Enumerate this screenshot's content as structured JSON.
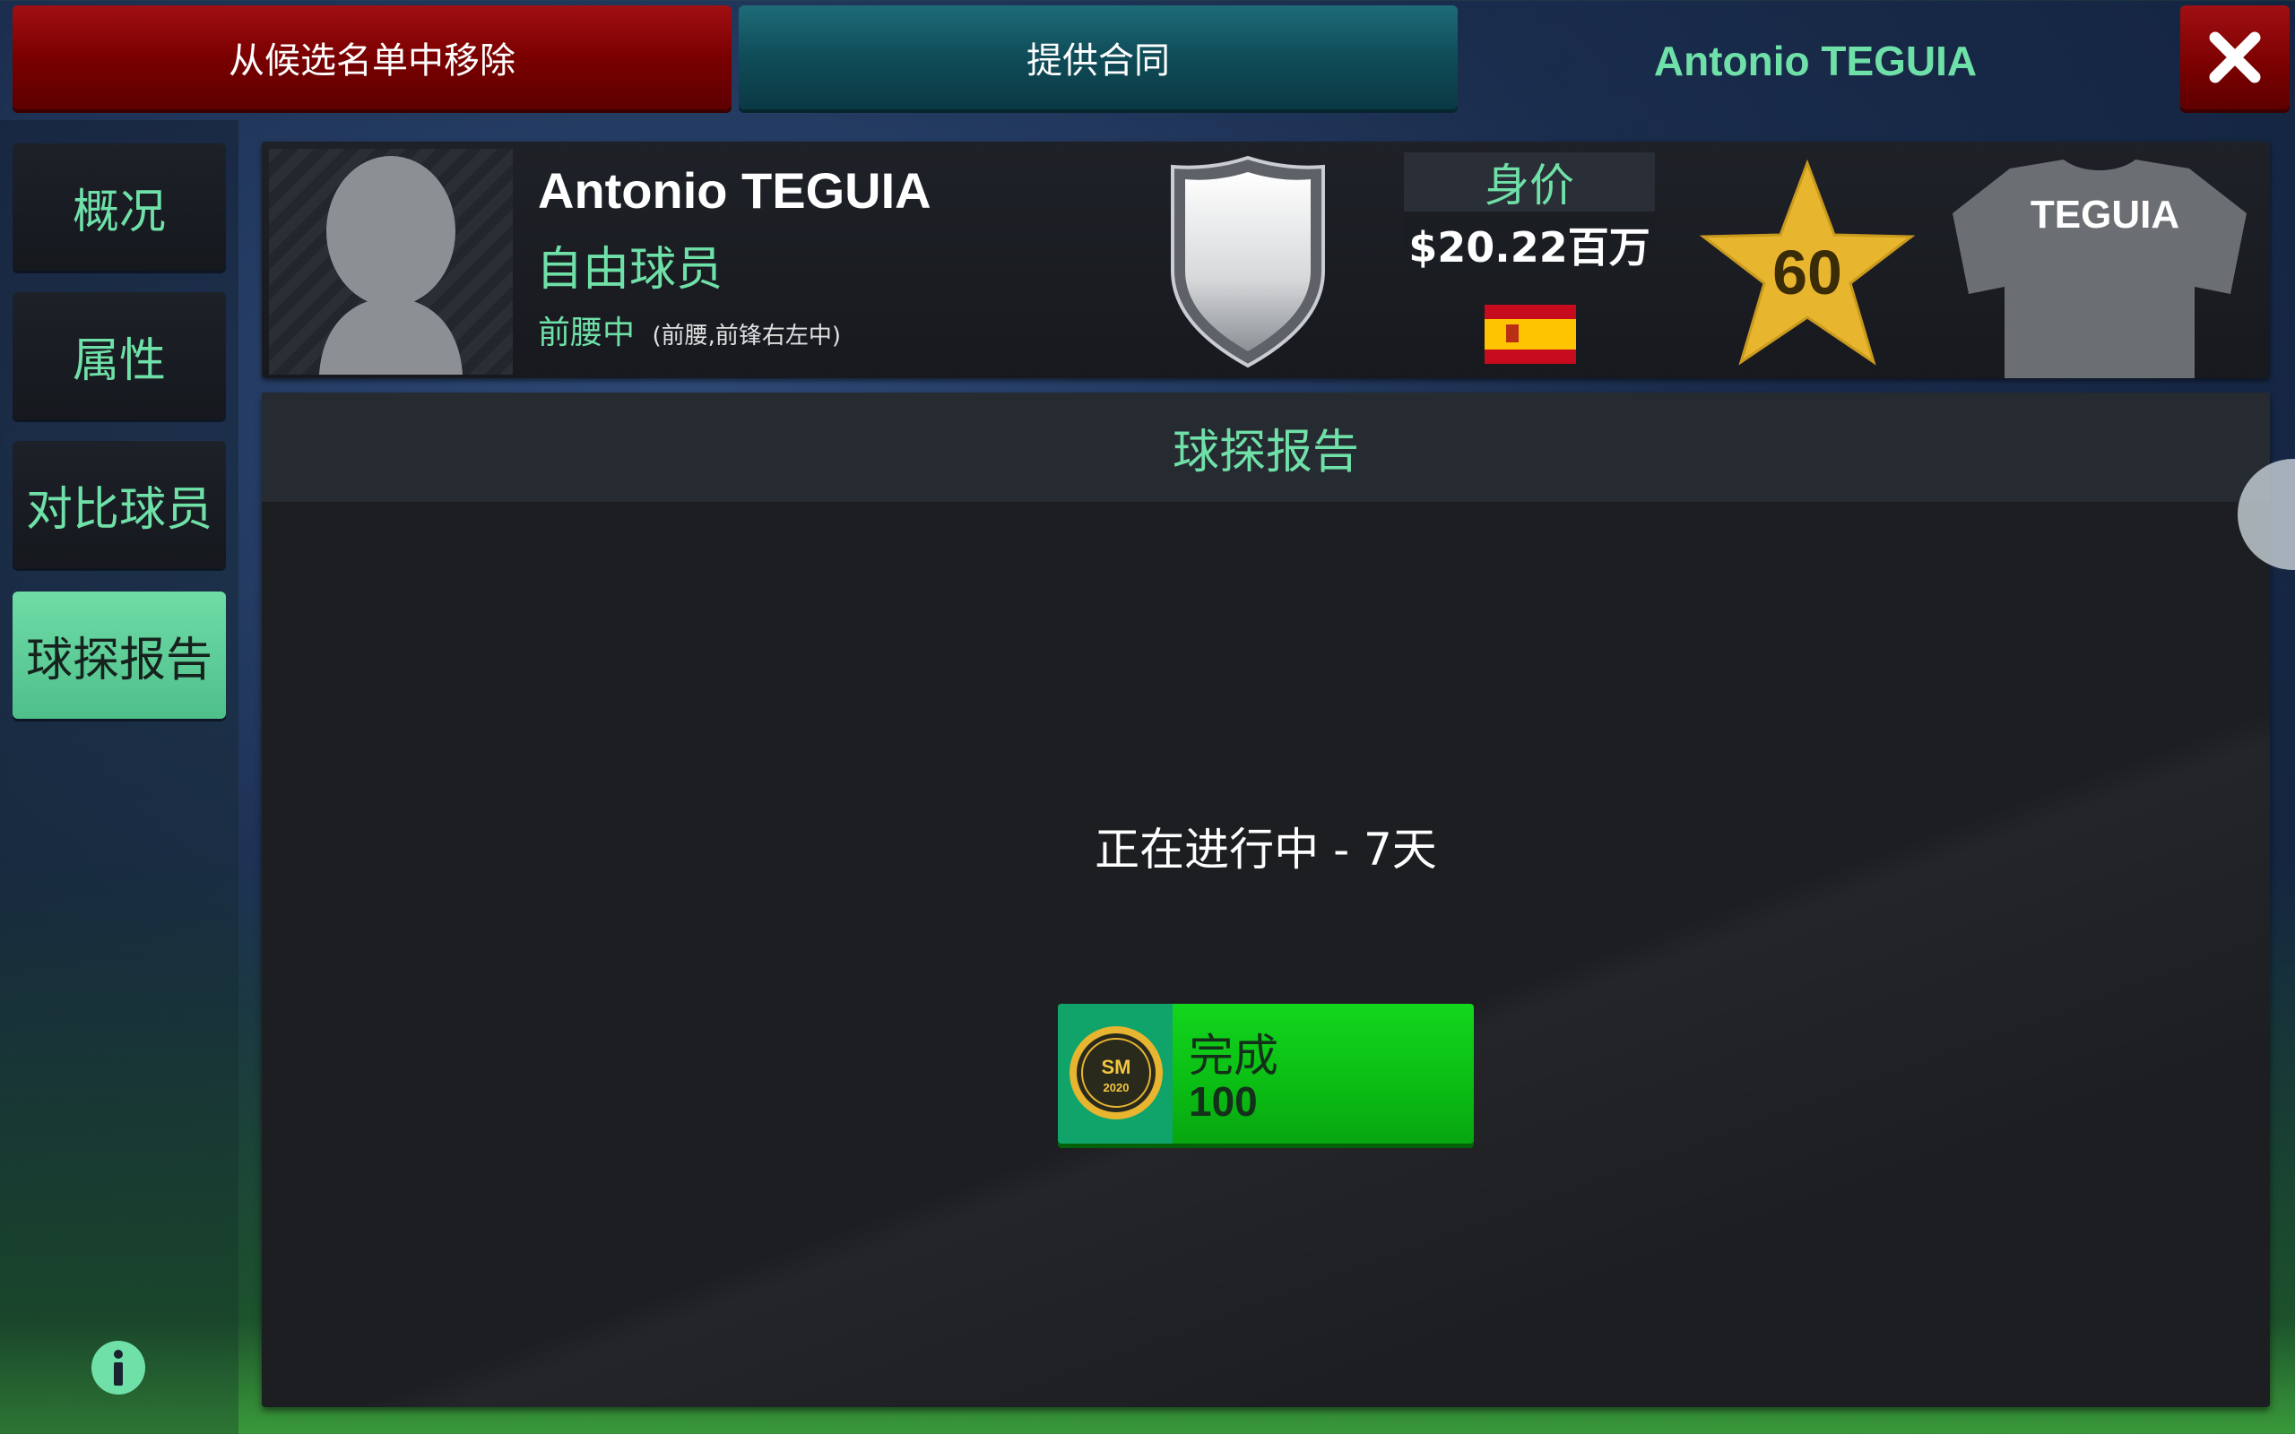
{
  "topbar": {
    "remove_label": "从候选名单中移除",
    "offer_label": "提供合同",
    "title": "Antonio TEGUIA",
    "close_icon": "close-icon"
  },
  "sidebar": {
    "items": [
      {
        "label": "概况",
        "active": false
      },
      {
        "label": "属性",
        "active": false
      },
      {
        "label": "对比球员",
        "active": false
      },
      {
        "label": "球探报告",
        "active": true
      }
    ],
    "info_icon": "info-icon"
  },
  "player": {
    "name": "Antonio TEGUIA",
    "status": "自由球员",
    "position": "前腰中",
    "position_detail": "(前腰,前锋右左中)",
    "value_label": "身价",
    "value": "$20.22百万",
    "nationality_flag": "spain-flag-icon",
    "rating": "60",
    "shirt_name": "TEGUIA"
  },
  "report": {
    "title": "球探报告",
    "progress": "正在进行中 - 7天",
    "complete_label": "完成",
    "complete_cost": "100",
    "coin_text": "SM",
    "coin_year": "2020"
  },
  "colors": {
    "accent": "#6fe0a8",
    "remove": "#7a0000",
    "offer": "#0f4c58",
    "complete": "#0bbf14",
    "star": "#e8b52e"
  }
}
